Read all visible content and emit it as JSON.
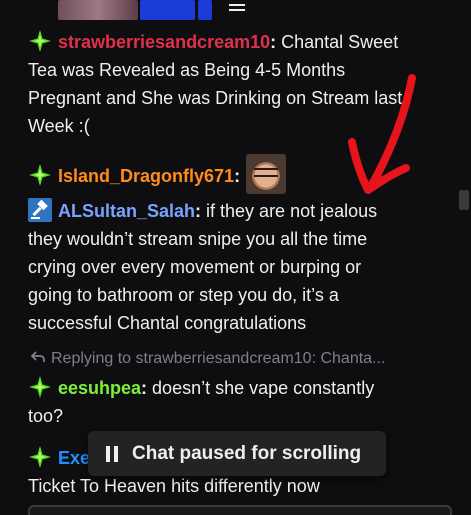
{
  "messages": [
    {
      "username": "strawberriesandcream10",
      "text_lines": [
        "Chantal Sweet",
        "Tea was Revealed as Being 4-5 Months",
        "Pregnant and She was Drinking on Stream last",
        "Week :("
      ]
    },
    {
      "username": "Island_Dragonfly671",
      "emote": "face-emote"
    },
    {
      "username": "ALSultan_Salah",
      "text_lines": [
        "if they are not jealous",
        "they wouldn’t stream snipe you all the time",
        "crying over every movement or burping or",
        "going to bathroom or step you do, it’s a",
        "successful Chantal congratulations"
      ]
    },
    {
      "reply_text": "Replying to strawberriesandcream10: Chanta...",
      "username": "eesuhpea",
      "text_lines": [
        "doesn’t she vape constantly",
        "too?"
      ]
    },
    {
      "username": "Exe",
      "text_lines": [
        "Ticket To Heaven hits differently now"
      ]
    }
  ],
  "paused_banner": "Chat paused for scrolling",
  "colors": {
    "background": "#0e0e10",
    "username_red": "#e0314b",
    "username_orange": "#ff8c1a",
    "username_blue": "#7aa3ff",
    "username_green": "#7df03c",
    "username_blue2": "#1e90ff",
    "annotation_arrow": "#e8141c",
    "badge_green": "#57e01a",
    "mod_badge": "#2f74c0"
  },
  "icons": [
    "sparkle-badge-icon",
    "mod-gavel-badge-icon",
    "reply-arrow-icon",
    "pause-icon"
  ]
}
